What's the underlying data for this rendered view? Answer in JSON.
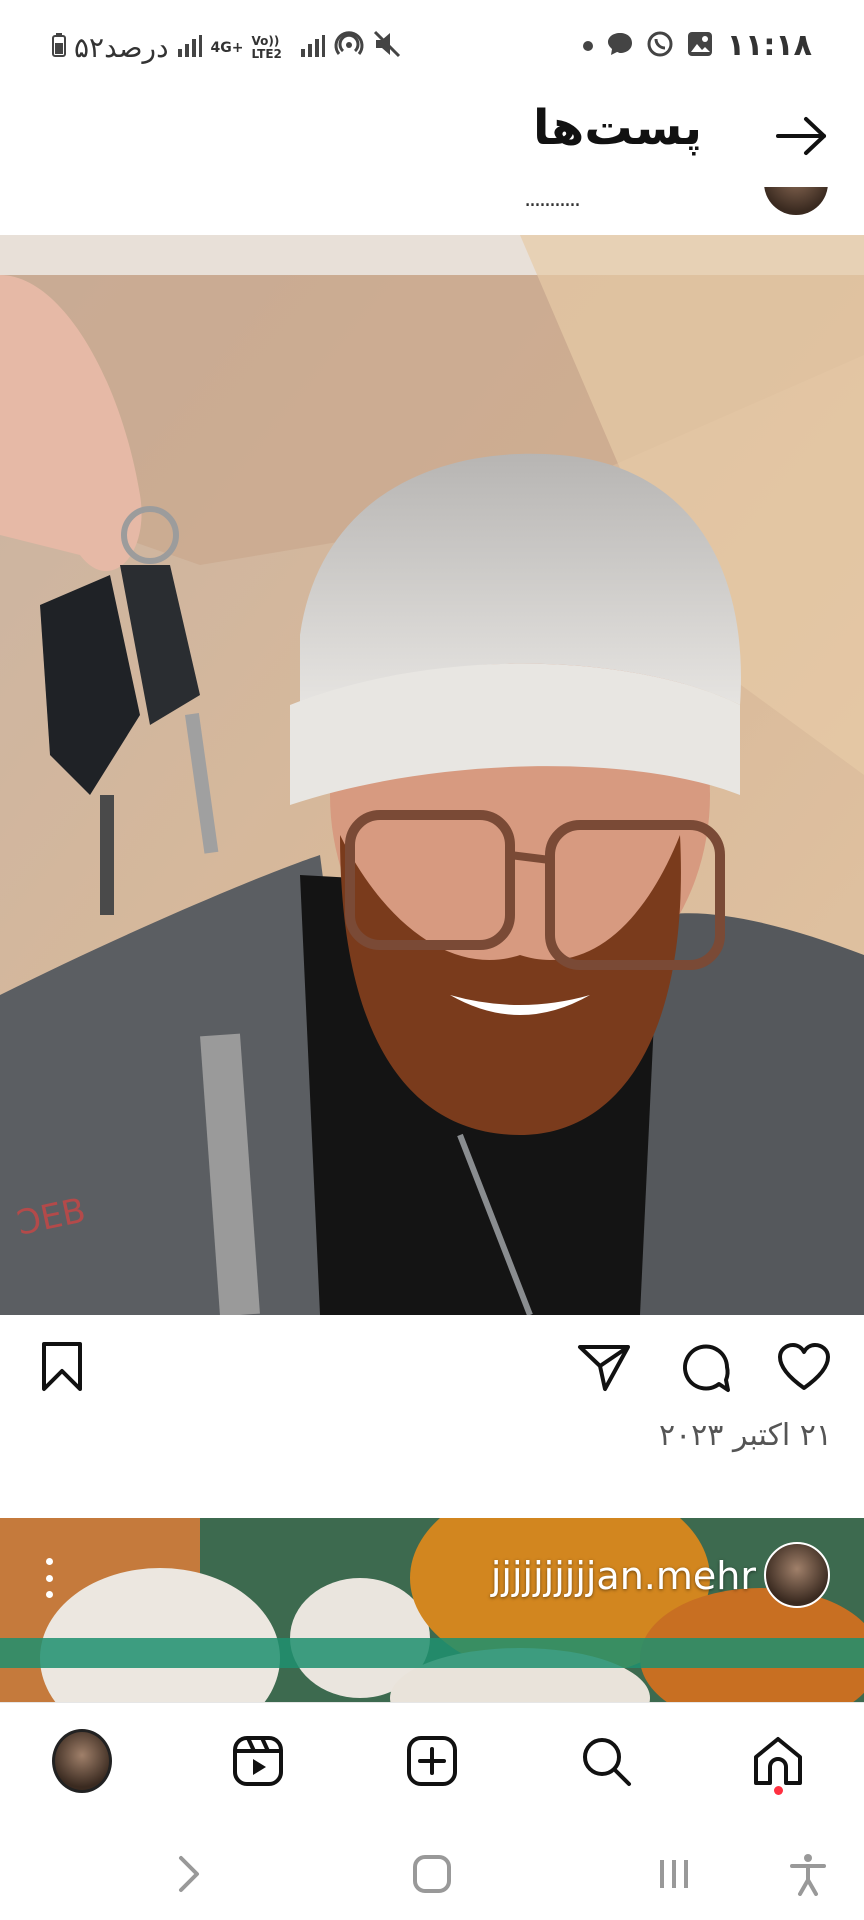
{
  "status_bar": {
    "time": "۱۱:۱۸",
    "battery_text": "۵۲درصد",
    "network_labels": [
      "4G+",
      "Vo)) LTE2"
    ]
  },
  "header": {
    "title": "پست‌ها"
  },
  "previous_post": {
    "caption_fragment": "..........."
  },
  "post": {
    "date": "۲۱ اکتبر ۲۰۲۳"
  },
  "next_post": {
    "username": "jjjjjjjjjjan.mehr"
  },
  "colors": {
    "accent_dot": "#ff3040",
    "icon": "#111111"
  },
  "icons": {
    "back": "arrow-right-icon",
    "like": "heart-icon",
    "comment": "comment-bubble-icon",
    "share": "paper-plane-icon",
    "save": "bookmark-icon",
    "more": "three-dots-vertical-icon",
    "nav_home": "home-icon",
    "nav_search": "search-icon",
    "nav_create": "plus-square-icon",
    "nav_reels": "reels-icon",
    "nav_profile": "profile-avatar",
    "sys_back": "chevron-icon",
    "sys_home": "rounded-square-icon",
    "sys_recents": "three-bars-icon",
    "sys_accessibility": "accessibility-icon"
  }
}
